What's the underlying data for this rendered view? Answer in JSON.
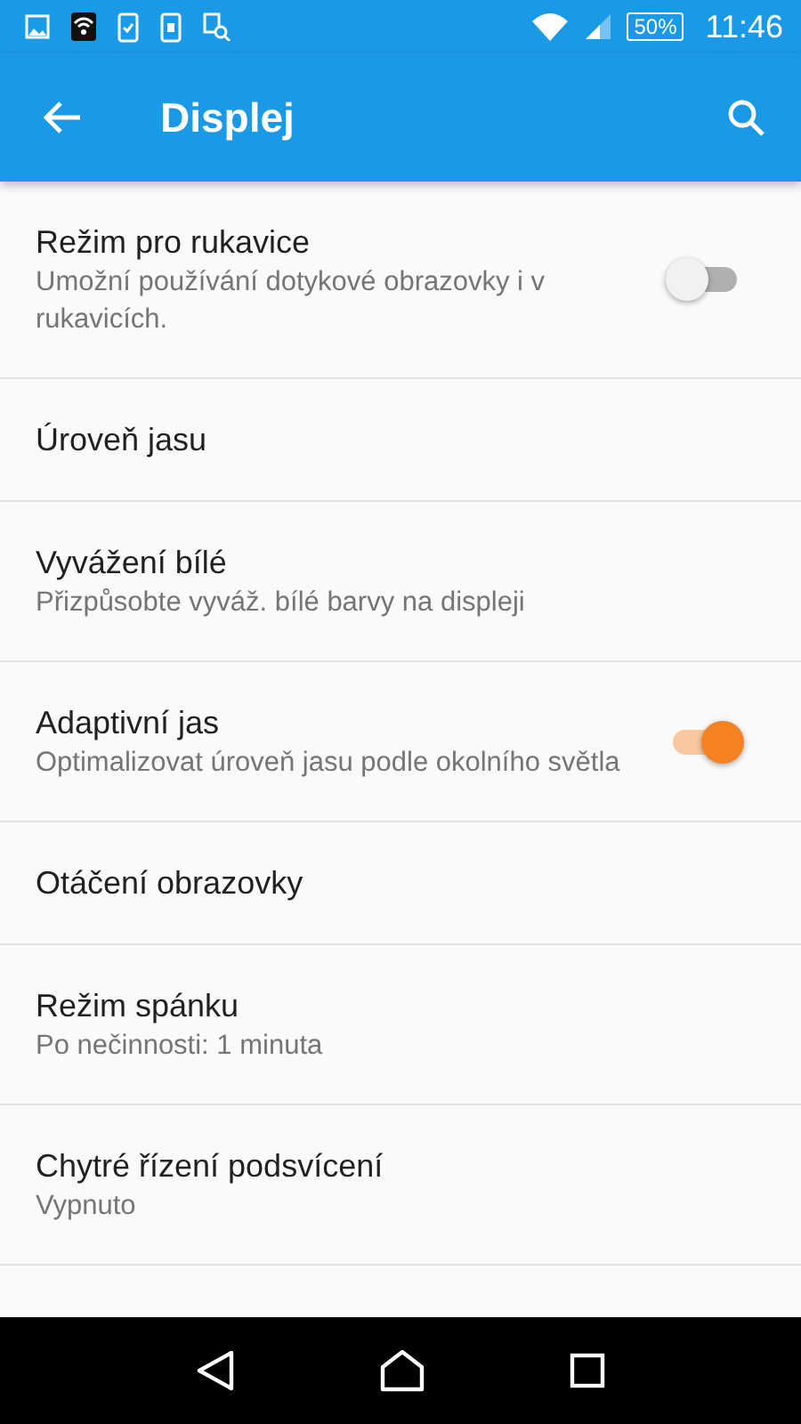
{
  "status_bar": {
    "battery": "50%",
    "time": "11:46"
  },
  "app_bar": {
    "title": "Displej"
  },
  "settings": [
    {
      "kind": "toggle",
      "title": "Režim pro rukavice",
      "subtitle": "Umožní používání dotykové obrazovky i v rukavicích.",
      "on": false
    },
    {
      "kind": "plain",
      "title": "Úroveň jasu"
    },
    {
      "kind": "plain",
      "title": "Vyvážení bílé",
      "subtitle": "Přizpůsobte vyváž. bílé barvy na displeji"
    },
    {
      "kind": "toggle",
      "title": "Adaptivní jas",
      "subtitle": "Optimalizovat úroveň jasu podle okolního světla",
      "on": true
    },
    {
      "kind": "plain",
      "title": "Otáčení obrazovky"
    },
    {
      "kind": "plain",
      "title": "Režim spánku",
      "subtitle": "Po nečinnosti: 1 minuta"
    },
    {
      "kind": "plain",
      "title": "Chytré řízení podsvícení",
      "subtitle": "Vypnuto"
    }
  ]
}
